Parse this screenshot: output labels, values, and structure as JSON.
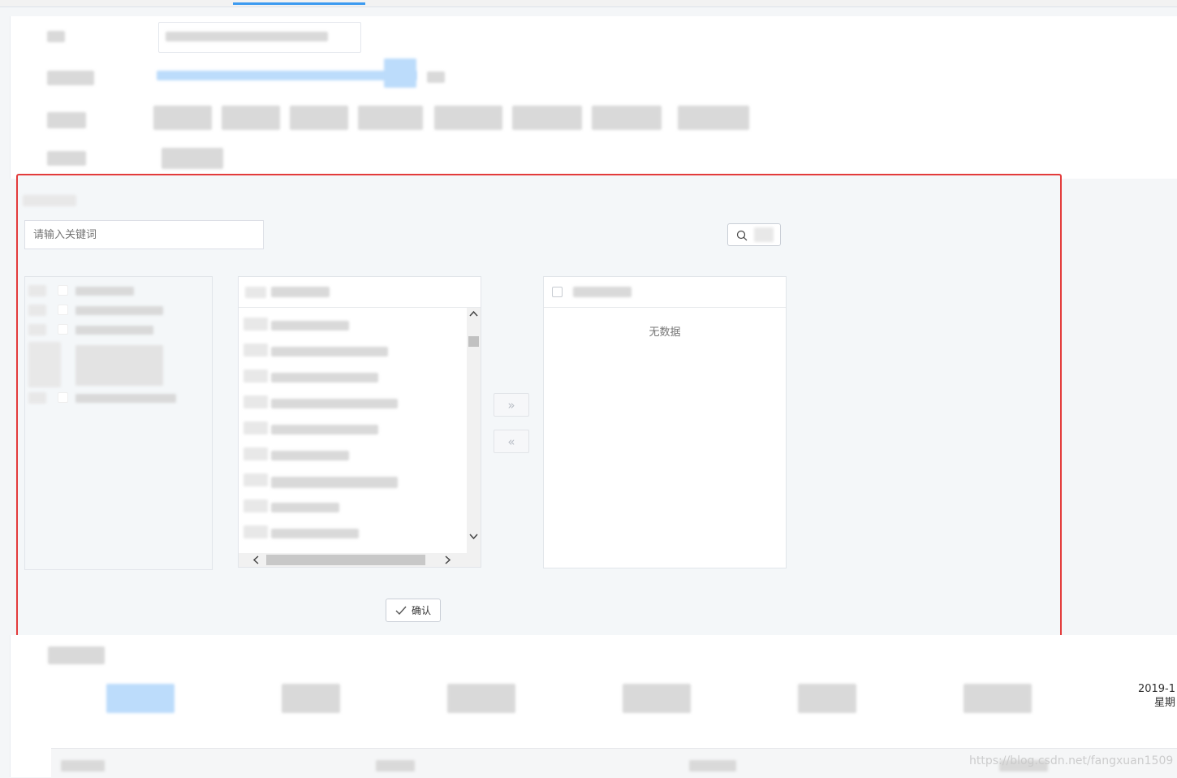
{
  "transfer": {
    "search_placeholder": "请输入关键词",
    "empty_text": "无数据",
    "move_right_symbol": "»",
    "move_left_symbol": "«",
    "confirm_label": "确认"
  },
  "header": {
    "date_line1": "2019-1",
    "date_line2": "星期"
  },
  "watermark": "https://blog.csdn.net/fangxuan1509",
  "icons": {
    "search": "search-icon",
    "check": "check-icon",
    "scroll_up": "chevron-up-icon",
    "scroll_down": "chevron-down-icon",
    "scroll_left": "chevron-left-icon",
    "scroll_right": "chevron-right-icon"
  },
  "colors": {
    "highlight_border": "#e33b3b",
    "active_tab": "#3c9af0",
    "panel_bg": "#f4f7f9"
  }
}
